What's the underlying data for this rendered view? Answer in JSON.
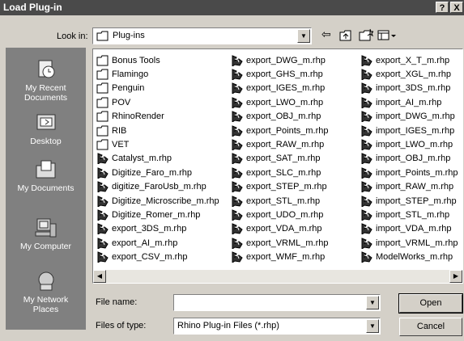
{
  "window": {
    "title": "Load Plug-in",
    "help_label": "?",
    "close_label": "X"
  },
  "lookin": {
    "label": "Look in:",
    "value": "Plug-ins"
  },
  "toolbar": {
    "back_icon": "back-arrow-icon",
    "up_icon": "up-folder-icon",
    "newfolder_icon": "new-folder-icon",
    "views_icon": "views-menu-icon"
  },
  "places": [
    {
      "label": "My Recent\nDocuments",
      "icon": "recent-documents-icon"
    },
    {
      "label": "Desktop",
      "icon": "desktop-icon"
    },
    {
      "label": "My Documents",
      "icon": "my-documents-icon"
    },
    {
      "label": "My Computer",
      "icon": "my-computer-icon"
    },
    {
      "label": "My Network\nPlaces",
      "icon": "network-places-icon"
    }
  ],
  "files": {
    "col1": [
      {
        "name": "Bonus Tools",
        "type": "folder"
      },
      {
        "name": "Flamingo",
        "type": "folder"
      },
      {
        "name": "Penguin",
        "type": "folder"
      },
      {
        "name": "POV",
        "type": "folder"
      },
      {
        "name": "RhinoRender",
        "type": "folder"
      },
      {
        "name": "RIB",
        "type": "folder"
      },
      {
        "name": "VET",
        "type": "folder"
      },
      {
        "name": "Catalyst_m.rhp",
        "type": "plugin"
      },
      {
        "name": "Digitize_Faro_m.rhp",
        "type": "plugin"
      },
      {
        "name": "digitize_FaroUsb_m.rhp",
        "type": "plugin"
      },
      {
        "name": "Digitize_Microscribe_m.rhp",
        "type": "plugin"
      },
      {
        "name": "Digitize_Romer_m.rhp",
        "type": "plugin"
      },
      {
        "name": "export_3DS_m.rhp",
        "type": "plugin"
      },
      {
        "name": "export_AI_m.rhp",
        "type": "plugin"
      },
      {
        "name": "export_CSV_m.rhp",
        "type": "plugin"
      }
    ],
    "col2": [
      {
        "name": "export_DWG_m.rhp",
        "type": "plugin"
      },
      {
        "name": "export_GHS_m.rhp",
        "type": "plugin"
      },
      {
        "name": "export_IGES_m.rhp",
        "type": "plugin"
      },
      {
        "name": "export_LWO_m.rhp",
        "type": "plugin"
      },
      {
        "name": "export_OBJ_m.rhp",
        "type": "plugin"
      },
      {
        "name": "export_Points_m.rhp",
        "type": "plugin"
      },
      {
        "name": "export_RAW_m.rhp",
        "type": "plugin"
      },
      {
        "name": "export_SAT_m.rhp",
        "type": "plugin"
      },
      {
        "name": "export_SLC_m.rhp",
        "type": "plugin"
      },
      {
        "name": "export_STEP_m.rhp",
        "type": "plugin"
      },
      {
        "name": "export_STL_m.rhp",
        "type": "plugin"
      },
      {
        "name": "export_UDO_m.rhp",
        "type": "plugin"
      },
      {
        "name": "export_VDA_m.rhp",
        "type": "plugin"
      },
      {
        "name": "export_VRML_m.rhp",
        "type": "plugin"
      },
      {
        "name": "export_WMF_m.rhp",
        "type": "plugin"
      }
    ],
    "col3": [
      {
        "name": "export_X_T_m.rhp",
        "type": "plugin"
      },
      {
        "name": "export_XGL_m.rhp",
        "type": "plugin"
      },
      {
        "name": "import_3DS_m.rhp",
        "type": "plugin"
      },
      {
        "name": "import_AI_m.rhp",
        "type": "plugin"
      },
      {
        "name": "import_DWG_m.rhp",
        "type": "plugin"
      },
      {
        "name": "import_IGES_m.rhp",
        "type": "plugin"
      },
      {
        "name": "import_LWO_m.rhp",
        "type": "plugin"
      },
      {
        "name": "import_OBJ_m.rhp",
        "type": "plugin"
      },
      {
        "name": "import_Points_m.rhp",
        "type": "plugin"
      },
      {
        "name": "import_RAW_m.rhp",
        "type": "plugin"
      },
      {
        "name": "import_STEP_m.rhp",
        "type": "plugin"
      },
      {
        "name": "import_STL_m.rhp",
        "type": "plugin"
      },
      {
        "name": "import_VDA_m.rhp",
        "type": "plugin"
      },
      {
        "name": "import_VRML_m.rhp",
        "type": "plugin"
      },
      {
        "name": "ModelWorks_m.rhp",
        "type": "plugin"
      }
    ]
  },
  "filename": {
    "label": "File name:",
    "value": ""
  },
  "filetype": {
    "label": "Files of type:",
    "value": "Rhino Plug-in Files (*.rhp)"
  },
  "buttons": {
    "open": "Open",
    "cancel": "Cancel"
  }
}
